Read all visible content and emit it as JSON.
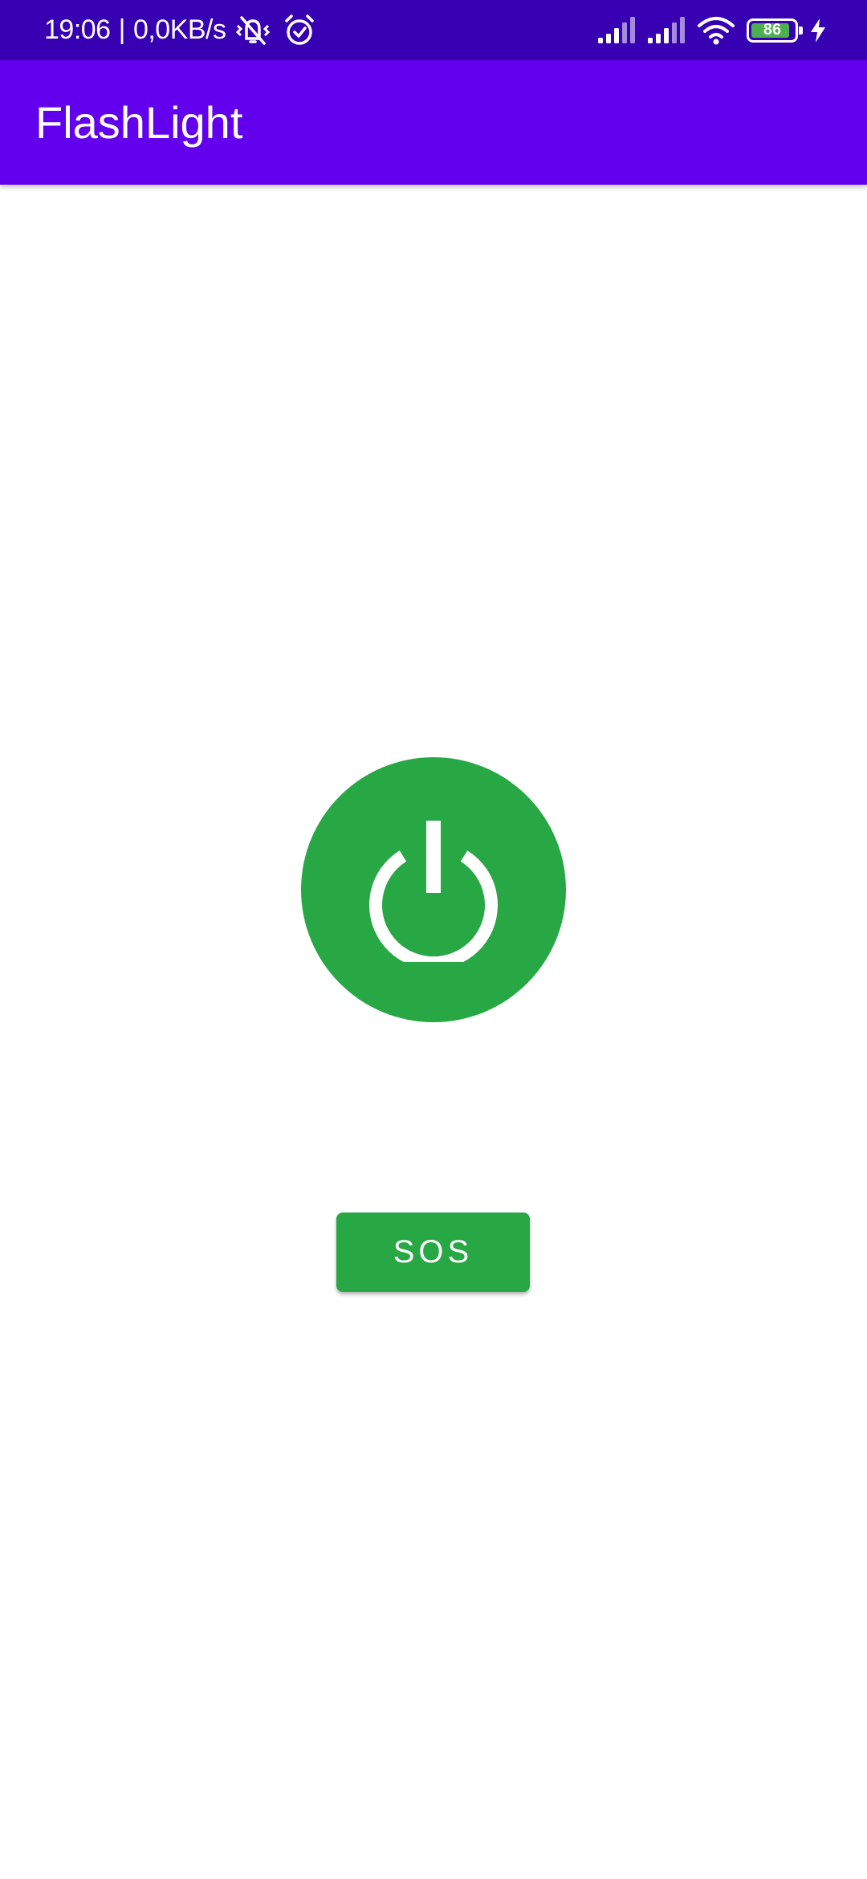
{
  "status_bar": {
    "time": "19:06",
    "separator": "|",
    "network_speed": "0,0KB/s",
    "battery_level": "86",
    "icons": [
      "vibrate-off-icon",
      "alarm-icon",
      "signal-icon",
      "signal-icon",
      "wifi-icon",
      "battery-icon",
      "charging-icon"
    ]
  },
  "app_bar": {
    "title": "FlashLight"
  },
  "main": {
    "power_button_icon": "power-icon",
    "sos_label": "SOS"
  },
  "colors": {
    "status_bar": "#3700B3",
    "app_bar": "#6200EE",
    "accent_green": "#28A745",
    "background": "#FFFFFF"
  }
}
